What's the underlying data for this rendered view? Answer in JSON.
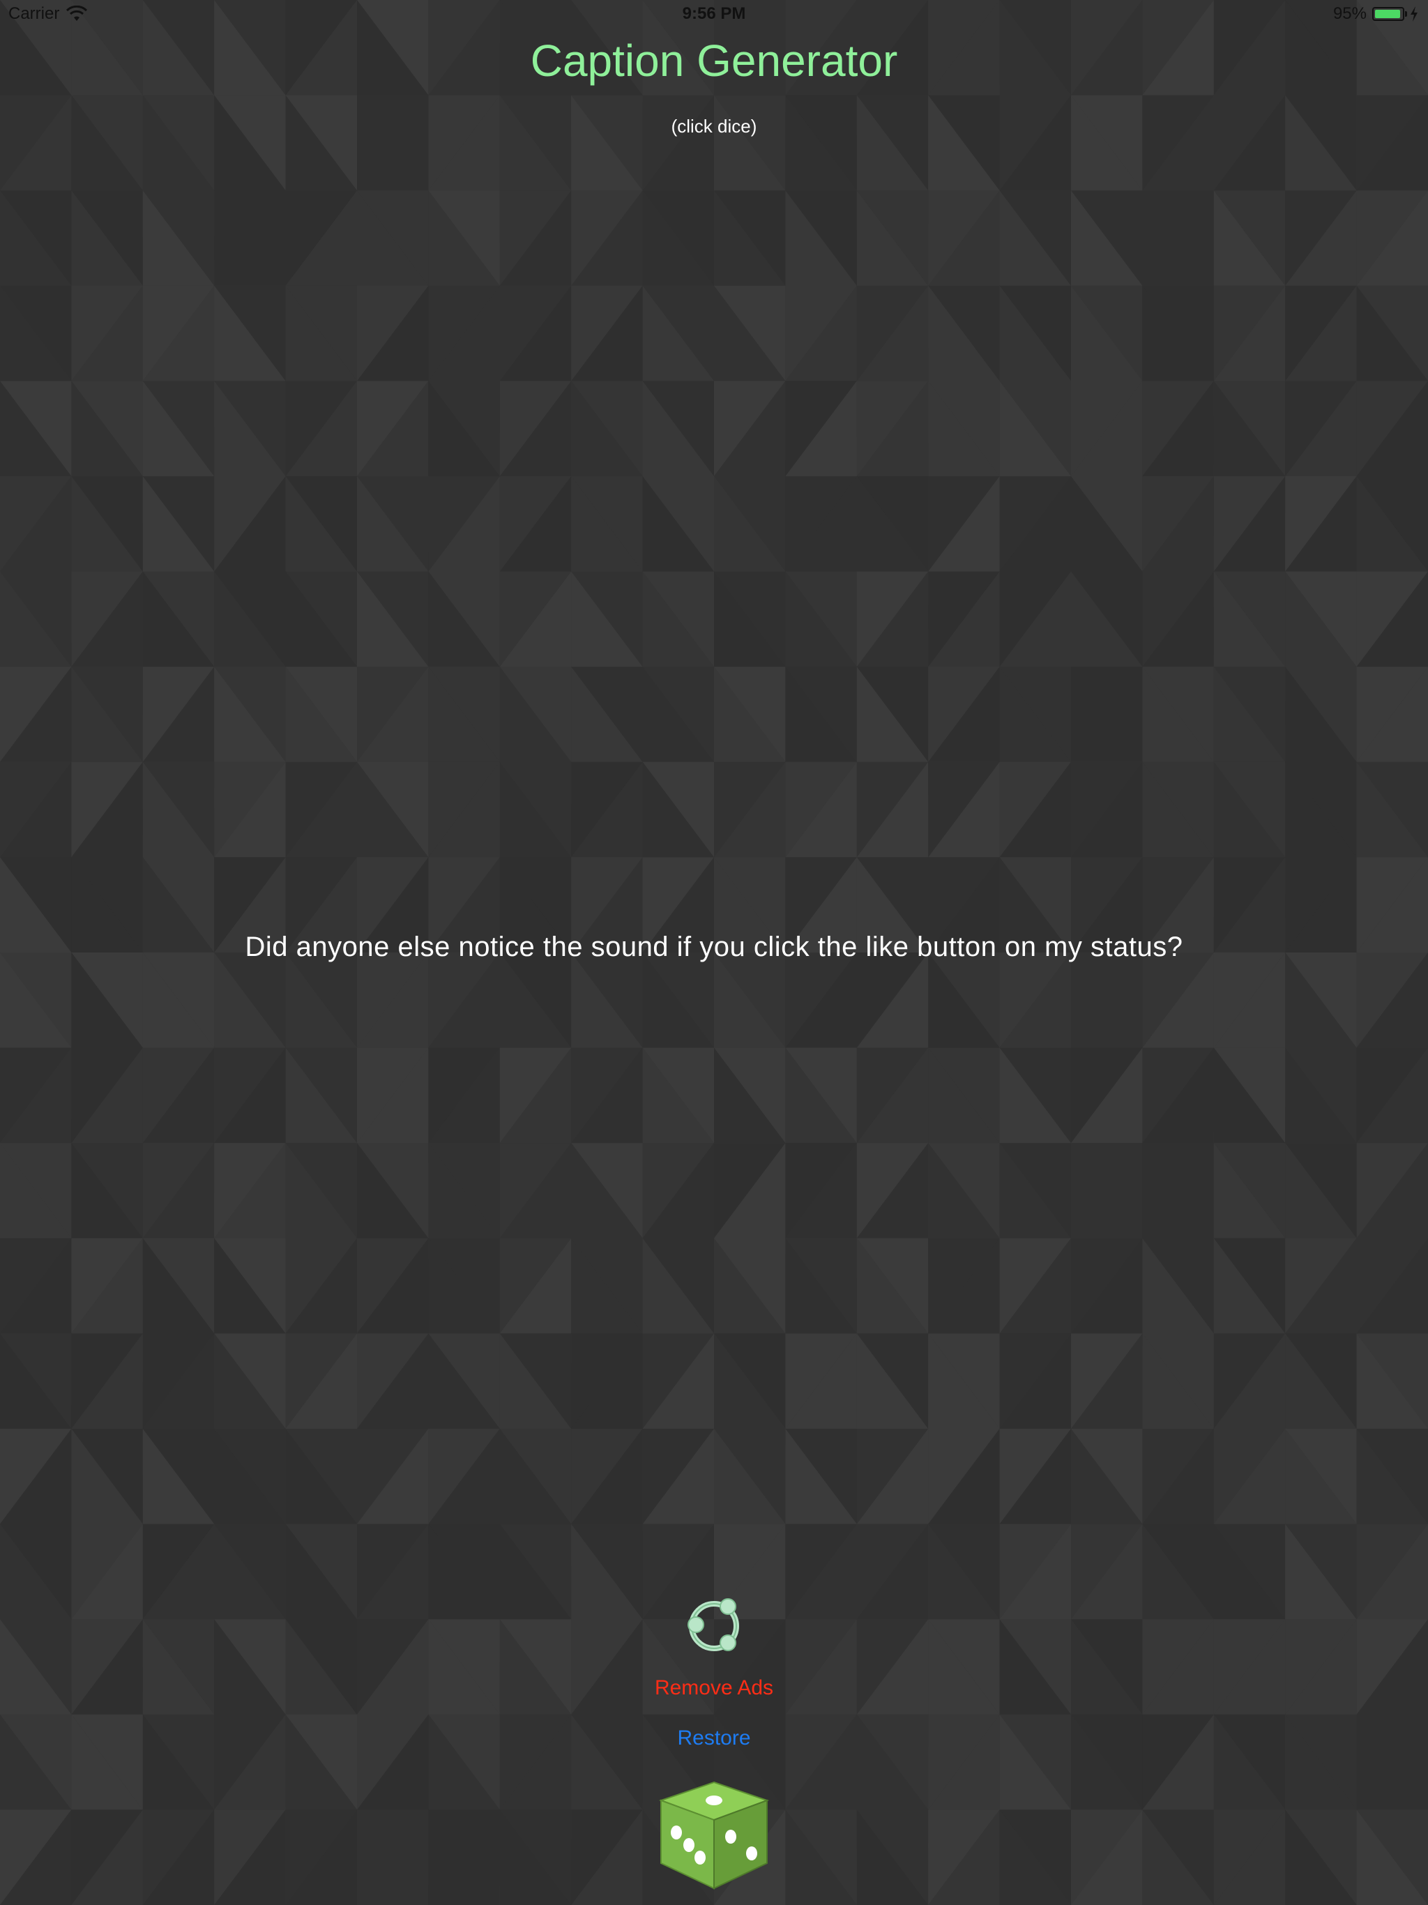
{
  "status_bar": {
    "carrier": "Carrier",
    "time": "9:56 PM",
    "battery_percent_label": "95%",
    "battery_level": 0.95
  },
  "header": {
    "title": "Caption Generator",
    "subtitle": "(click dice)"
  },
  "main": {
    "caption": "Did anyone else notice the sound if you click the like button on my status?"
  },
  "actions": {
    "remove_ads_label": "Remove Ads",
    "restore_label": "Restore"
  },
  "icons": {
    "share": "share-icon",
    "dice": "dice-icon",
    "wifi": "wifi-icon",
    "battery": "battery-icon",
    "charging": "charging-bolt-icon"
  },
  "colors": {
    "background": "#343434",
    "title": "#8ff09a",
    "caption": "#ffffff",
    "remove_ads": "#ff2d16",
    "restore": "#1e7cf2",
    "dice_green": "#7bb849",
    "battery_fill": "#4cd964"
  }
}
